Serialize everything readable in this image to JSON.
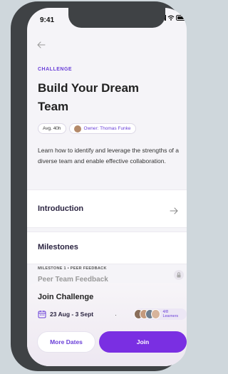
{
  "status_bar": {
    "time": "9:41"
  },
  "header": {
    "back_icon": "arrow-left-icon"
  },
  "challenge": {
    "eyebrow": "CHALLENGE",
    "title": "Build Your Dream Team",
    "avg_chip": "Avg. 40h",
    "owner_chip": "Owner: Thomas Funke",
    "description": "Learn how to identify and leverage the strengths of a diverse team and enable effective collaboration."
  },
  "sections": {
    "introduction": {
      "label": "Introduction",
      "icon": "arrow-right-icon"
    },
    "milestones": {
      "label": "Milestones"
    }
  },
  "milestone_preview": {
    "meta_label": "MILESTONE 1",
    "meta_type": "PEER FEEDBACK",
    "title_peek": "Peer Team Feedback",
    "lock_icon": "lock-icon"
  },
  "join_sheet": {
    "title": "Join Challenge",
    "date_range": "23 Aug - 3 Sept",
    "learners": "4/8 Learners",
    "more_dates_label": "More Dates",
    "join_label": "Join"
  },
  "colors": {
    "accent": "#7a2fe2",
    "accent_text": "#6a3fd8",
    "phone_frame": "#3f4245"
  }
}
